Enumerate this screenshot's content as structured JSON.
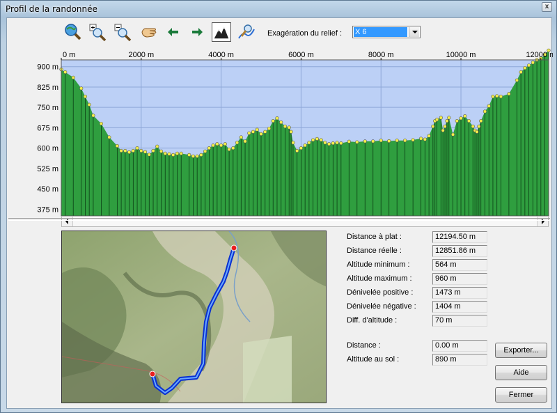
{
  "window": {
    "title": "Profil de la randonnée",
    "close_glyph": "x"
  },
  "toolbar": {
    "tools": [
      {
        "name": "zoom-fit-icon"
      },
      {
        "name": "zoom-in-icon"
      },
      {
        "name": "zoom-out-icon"
      },
      {
        "name": "pan-hand-icon"
      },
      {
        "name": "arrow-left-icon"
      },
      {
        "name": "arrow-right-icon"
      },
      {
        "name": "relief-view-icon",
        "active": true
      },
      {
        "name": "path-tool-icon"
      }
    ],
    "exaggeration_label": "Exagération du relief :",
    "exaggeration_value": "X 6"
  },
  "chart_data": {
    "type": "area",
    "x_unit": "m",
    "x_ticks": [
      "0 m",
      "2000 m",
      "4000 m",
      "6000 m",
      "8000 m",
      "10000 m",
      "12000 m"
    ],
    "y_ticks": [
      "900 m",
      "825 m",
      "750 m",
      "675 m",
      "600 m",
      "525 m",
      "450 m",
      "375 m"
    ],
    "xlim": [
      0,
      12194.5
    ],
    "ylim": [
      350,
      925
    ],
    "grid": true,
    "x": [
      0,
      100,
      300,
      500,
      600,
      700,
      800,
      1000,
      1200,
      1400,
      1500,
      1600,
      1700,
      1800,
      1900,
      2000,
      2100,
      2200,
      2300,
      2400,
      2500,
      2600,
      2700,
      2800,
      2900,
      3000,
      3200,
      3300,
      3400,
      3500,
      3600,
      3700,
      3800,
      3900,
      4000,
      4100,
      4200,
      4300,
      4400,
      4500,
      4600,
      4700,
      4800,
      4900,
      5000,
      5100,
      5200,
      5300,
      5400,
      5500,
      5600,
      5700,
      5750,
      5800,
      5900,
      6000,
      6100,
      6200,
      6300,
      6400,
      6500,
      6600,
      6700,
      6800,
      6900,
      7000,
      7200,
      7400,
      7600,
      7800,
      8000,
      8200,
      8400,
      8600,
      8800,
      9000,
      9100,
      9200,
      9300,
      9350,
      9400,
      9500,
      9550,
      9600,
      9650,
      9700,
      9800,
      9900,
      10000,
      10100,
      10200,
      10300,
      10350,
      10400,
      10450,
      10500,
      10600,
      10700,
      10800,
      10900,
      11000,
      11200,
      11400,
      11500,
      11600,
      11700,
      11800,
      11900,
      12000,
      12100,
      12194.5
    ],
    "values": [
      890,
      880,
      860,
      820,
      790,
      760,
      720,
      690,
      640,
      608,
      590,
      590,
      585,
      590,
      600,
      590,
      586,
      576,
      590,
      606,
      588,
      580,
      578,
      575,
      580,
      580,
      575,
      570,
      570,
      575,
      588,
      600,
      610,
      615,
      610,
      615,
      595,
      600,
      620,
      640,
      625,
      655,
      660,
      668,
      652,
      660,
      672,
      700,
      710,
      695,
      680,
      676,
      660,
      620,
      590,
      600,
      610,
      620,
      630,
      634,
      630,
      620,
      615,
      618,
      620,
      618,
      624,
      622,
      625,
      625,
      628,
      626,
      628,
      628,
      630,
      635,
      632,
      645,
      680,
      700,
      705,
      712,
      665,
      680,
      700,
      712,
      650,
      700,
      710,
      718,
      700,
      680,
      665,
      660,
      680,
      700,
      735,
      755,
      790,
      792,
      790,
      800,
      850,
      880,
      895,
      905,
      915,
      925,
      930,
      945,
      960
    ]
  },
  "map": {
    "name": "route-map"
  },
  "stats": [
    {
      "label": "Distance à plat :",
      "value": "12194.50 m"
    },
    {
      "label": "Distance réelle :",
      "value": "12851.86 m"
    },
    {
      "label": "Altitude minimum :",
      "value": "564 m"
    },
    {
      "label": "Altitude maximum :",
      "value": "960 m"
    },
    {
      "label": "Dénivelée positive :",
      "value": "1473 m"
    },
    {
      "label": "Dénivelée négative :",
      "value": "1404 m"
    },
    {
      "label": "Diff. d'altitude :",
      "value": "70 m"
    }
  ],
  "cursor": [
    {
      "label": "Distance :",
      "value": "0.00 m"
    },
    {
      "label": "Altitude au sol :",
      "value": "890 m"
    }
  ],
  "buttons": {
    "export": "Exporter...",
    "help": "Aide",
    "close": "Fermer"
  }
}
